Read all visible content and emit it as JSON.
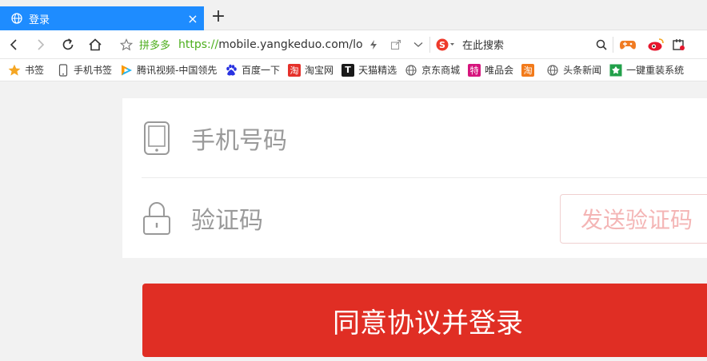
{
  "tab": {
    "title": "登录",
    "close": "×",
    "new_tab": "+"
  },
  "toolbar": {
    "site_name": "拼多多",
    "url_scheme": "https://",
    "url_rest": "mobile.yangkeduo.com/log",
    "search_placeholder": "在此搜索",
    "search_engine_icon": "sogou-icon"
  },
  "bookmarks": [
    {
      "icon": "star-icon",
      "label": "书签",
      "color": "#f5a623"
    },
    {
      "icon": "phone-icon",
      "label": "手机书签",
      "color": "#666666"
    },
    {
      "icon": "tencent-video-icon",
      "label": "腾讯视频-中国领先",
      "color": "#20b5f1"
    },
    {
      "icon": "baidu-icon",
      "label": "百度一下",
      "color": "#2932e1"
    },
    {
      "icon": "taobao-icon",
      "label": "淘宝网",
      "glyph": "淘",
      "color": "#e5312b"
    },
    {
      "icon": "tmall-icon",
      "label": "天猫精选",
      "glyph": "T",
      "color": "#d80b1e"
    },
    {
      "icon": "globe-icon",
      "label": "京东商城",
      "color": "#666666"
    },
    {
      "icon": "vip-icon",
      "label": "唯品会",
      "glyph": "特",
      "color": "#d6157d"
    },
    {
      "icon": "taobao-orange-icon",
      "label": "",
      "glyph": "淘",
      "color": "#f27a1a"
    },
    {
      "icon": "globe-icon",
      "label": "头条新闻",
      "color": "#666666"
    },
    {
      "icon": "reinstall-icon",
      "label": "一键重装系统",
      "color": "#22a04a"
    }
  ],
  "login": {
    "phone_placeholder": "手机号码",
    "code_placeholder": "验证码",
    "send_code_label": "发送验证码",
    "submit_label": "同意协议并登录"
  },
  "colors": {
    "accent_red": "#e02e24",
    "tab_blue": "#1e8cff",
    "brand_green": "#4cae1c"
  }
}
